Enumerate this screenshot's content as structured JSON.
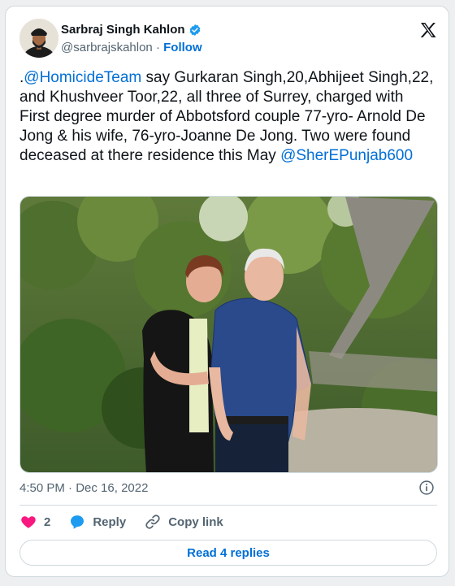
{
  "author": {
    "name": "Sarbraj Singh Kahlon",
    "handle": "@sarbrajskahlon",
    "separator": "·",
    "follow_label": "Follow"
  },
  "tweet": {
    "text_prefix": ".",
    "mention_1": "@HomicideTeam",
    "text_body": " say Gurkaran Singh,20,Abhijeet Singh,22, and Khushveer Toor,22, all three of Surrey, charged with First degree murder of Abbotsford couple 77-yro- Arnold De Jong & his wife, 76-yro-Joanne De Jong. Two were found deceased at there residence this May ",
    "mention_2": "@SherEPunjab600"
  },
  "meta": {
    "time": "4:50 PM",
    "separator": "·",
    "date": "Dec 16, 2022"
  },
  "actions": {
    "like_count": "2",
    "reply_label": "Reply",
    "copy_link_label": "Copy link"
  },
  "read_replies_label": "Read 4 replies",
  "icons": {
    "verified": "verified-badge-icon",
    "x_logo": "x-logo-icon",
    "info": "info-icon",
    "heart": "heart-icon",
    "reply": "speech-bubble-icon",
    "link": "link-icon"
  },
  "colors": {
    "link_blue": "#006fd6",
    "heart_pink": "#f91880",
    "reply_blue": "#1d9bf0",
    "muted": "#536471"
  }
}
